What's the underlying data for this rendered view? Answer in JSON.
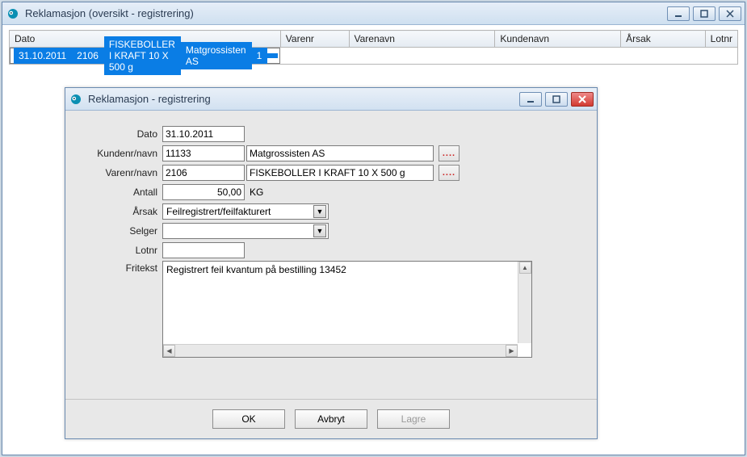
{
  "mainWindow": {
    "title": "Reklamasjon (oversikt - registrering)"
  },
  "grid": {
    "headers": [
      "Dato",
      "Varenr",
      "Varenavn",
      "Kundenavn",
      "Årsak",
      "Lotnr"
    ],
    "row": {
      "dato": "31.10.2011",
      "varenr": "2106",
      "varenavn": "FISKEBOLLER I KRAFT 10 X 500 g",
      "kundenavn": "Matgrossisten AS",
      "arsak": "1",
      "lotnr": ""
    }
  },
  "dialog": {
    "title": "Reklamasjon - registrering",
    "labels": {
      "dato": "Dato",
      "kundenr": "Kundenr/navn",
      "varenr": "Varenr/navn",
      "antall": "Antall",
      "arsak": "Årsak",
      "selger": "Selger",
      "lotnr": "Lotnr",
      "fritekst": "Fritekst"
    },
    "values": {
      "dato": "31.10.2011",
      "kundenr": "11133",
      "kundenavn": "Matgrossisten AS",
      "varenr": "2106",
      "varenavn": "FISKEBOLLER I KRAFT 10 X 500 g",
      "antall": "50,00",
      "antall_unit": "KG",
      "arsak": "Feilregistrert/feilfakturert",
      "selger": "",
      "lotnr": "",
      "fritekst": "Registrert feil kvantum på bestilling 13452"
    },
    "buttons": {
      "ok": "OK",
      "cancel": "Avbryt",
      "save": "Lagre"
    },
    "lookup": "...."
  }
}
